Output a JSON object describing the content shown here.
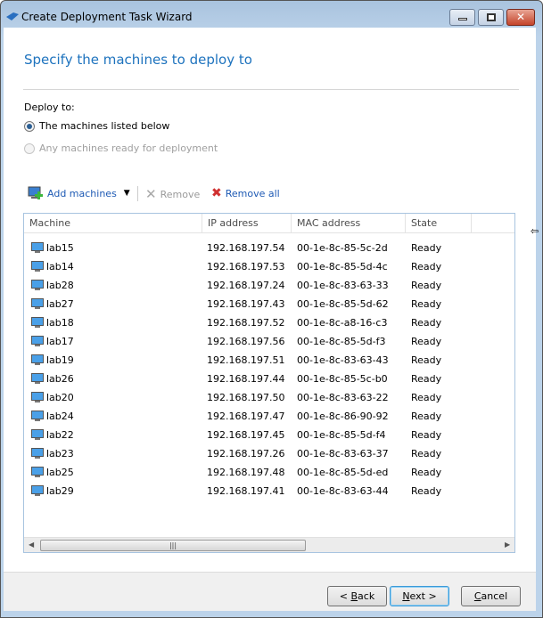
{
  "window": {
    "title": "Create Deployment Task Wizard",
    "close_glyph": "✕"
  },
  "page": {
    "heading": "Specify the machines to deploy to",
    "deploy_to_label": "Deploy to:"
  },
  "radios": [
    {
      "label": "The machines listed below",
      "selected": true,
      "enabled": true
    },
    {
      "label": "Any machines ready for deployment",
      "selected": false,
      "enabled": false
    }
  ],
  "toolbar": {
    "add": "Add machines",
    "remove": "Remove",
    "remove_all": "Remove all"
  },
  "table": {
    "columns": [
      "Machine",
      "IP address",
      "MAC address",
      "State"
    ],
    "rows": [
      [
        "lab15",
        "192.168.197.54",
        "00-1e-8c-85-5c-2d",
        "Ready"
      ],
      [
        "lab14",
        "192.168.197.53",
        "00-1e-8c-85-5d-4c",
        "Ready"
      ],
      [
        "lab28",
        "192.168.197.24",
        "00-1e-8c-83-63-33",
        "Ready"
      ],
      [
        "lab27",
        "192.168.197.43",
        "00-1e-8c-85-5d-62",
        "Ready"
      ],
      [
        "lab18",
        "192.168.197.52",
        "00-1e-8c-a8-16-c3",
        "Ready"
      ],
      [
        "lab17",
        "192.168.197.56",
        "00-1e-8c-85-5d-f3",
        "Ready"
      ],
      [
        "lab19",
        "192.168.197.51",
        "00-1e-8c-83-63-43",
        "Ready"
      ],
      [
        "lab26",
        "192.168.197.44",
        "00-1e-8c-85-5c-b0",
        "Ready"
      ],
      [
        "lab20",
        "192.168.197.50",
        "00-1e-8c-83-63-22",
        "Ready"
      ],
      [
        "lab24",
        "192.168.197.47",
        "00-1e-8c-86-90-92",
        "Ready"
      ],
      [
        "lab22",
        "192.168.197.45",
        "00-1e-8c-85-5d-f4",
        "Ready"
      ],
      [
        "lab23",
        "192.168.197.26",
        "00-1e-8c-83-63-37",
        "Ready"
      ],
      [
        "lab25",
        "192.168.197.48",
        "00-1e-8c-85-5d-ed",
        "Ready"
      ],
      [
        "lab29",
        "192.168.197.41",
        "00-1e-8c-83-63-44",
        "Ready"
      ]
    ]
  },
  "buttons": {
    "back": {
      "pre": "< ",
      "key": "B",
      "post": "ack"
    },
    "next": {
      "pre": "",
      "key": "N",
      "post": "ext >"
    },
    "cancel": {
      "pre": "",
      "key": "C",
      "post": "ancel"
    }
  },
  "colors": {
    "accent": "#1e73be",
    "link": "#1e5ab4"
  }
}
